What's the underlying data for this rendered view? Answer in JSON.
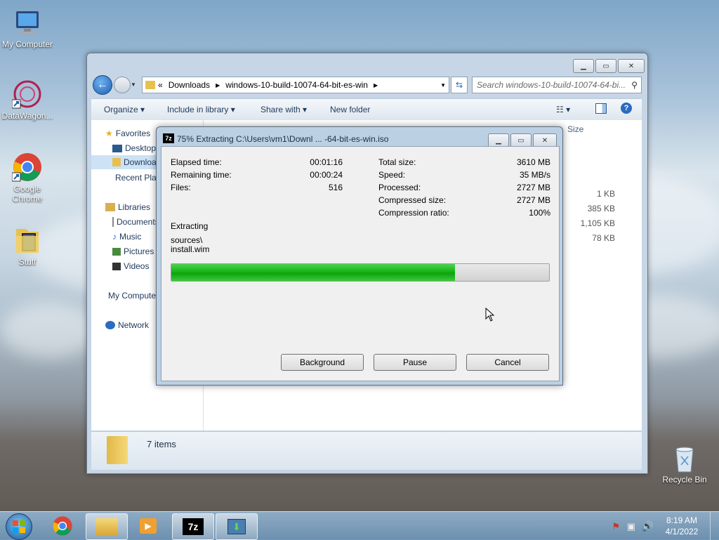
{
  "desktop": {
    "icons": [
      {
        "label": "My Computer",
        "icon": "computer-icon"
      },
      {
        "label": "DataWagon...",
        "icon": "datawagon-icon"
      },
      {
        "label": "Google Chrome",
        "icon": "chrome-icon"
      },
      {
        "label": "Stuff",
        "icon": "folder-icon"
      },
      {
        "label": "Recycle Bin",
        "icon": "recycle-bin-icon"
      }
    ]
  },
  "explorer": {
    "address": {
      "prefix": "«",
      "crumbs": [
        "Downloads",
        "windows-10-build-10074-64-bit-es-win"
      ]
    },
    "search_placeholder": "Search windows-10-build-10074-64-bi...",
    "toolbar": {
      "organize": "Organize",
      "include": "Include in library",
      "share": "Share with",
      "new_folder": "New folder"
    },
    "nav": {
      "favorites": "Favorites",
      "desktop": "Desktop",
      "downloads": "Downloads",
      "recent": "Recent Places",
      "libraries": "Libraries",
      "documents": "Documents",
      "music": "Music",
      "pictures": "Pictures",
      "videos": "Videos",
      "my_computer": "My Computer",
      "network": "Network"
    },
    "columns": {
      "size": "Size"
    },
    "sizes": [
      "1 KB",
      "385 KB",
      "1,105 KB",
      "78 KB"
    ],
    "status": "7 items"
  },
  "dialog": {
    "title": "75% Extracting C:\\Users\\vm1\\Downl ... -64-bit-es-win.iso",
    "app_badge": "7z",
    "left": {
      "elapsed_label": "Elapsed time:",
      "elapsed": "00:01:16",
      "remaining_label": "Remaining time:",
      "remaining": "00:00:24",
      "files_label": "Files:",
      "files": "516"
    },
    "right": {
      "total_label": "Total size:",
      "total": "3610 MB",
      "speed_label": "Speed:",
      "speed": "35 MB/s",
      "processed_label": "Processed:",
      "processed": "2727 MB",
      "compressed_label": "Compressed size:",
      "compressed": "2727 MB",
      "ratio_label": "Compression ratio:",
      "ratio": "100%"
    },
    "action": "Extracting",
    "path_line1": "sources\\",
    "path_line2": "install.wim",
    "progress_percent": 75,
    "buttons": {
      "background": "Background",
      "pause": "Pause",
      "cancel": "Cancel"
    }
  },
  "taskbar": {
    "time": "8:19 AM",
    "date": "4/1/2022",
    "zip_label": "7z"
  },
  "colors": {
    "progress": "#16b516",
    "accent": "#1e395b"
  }
}
